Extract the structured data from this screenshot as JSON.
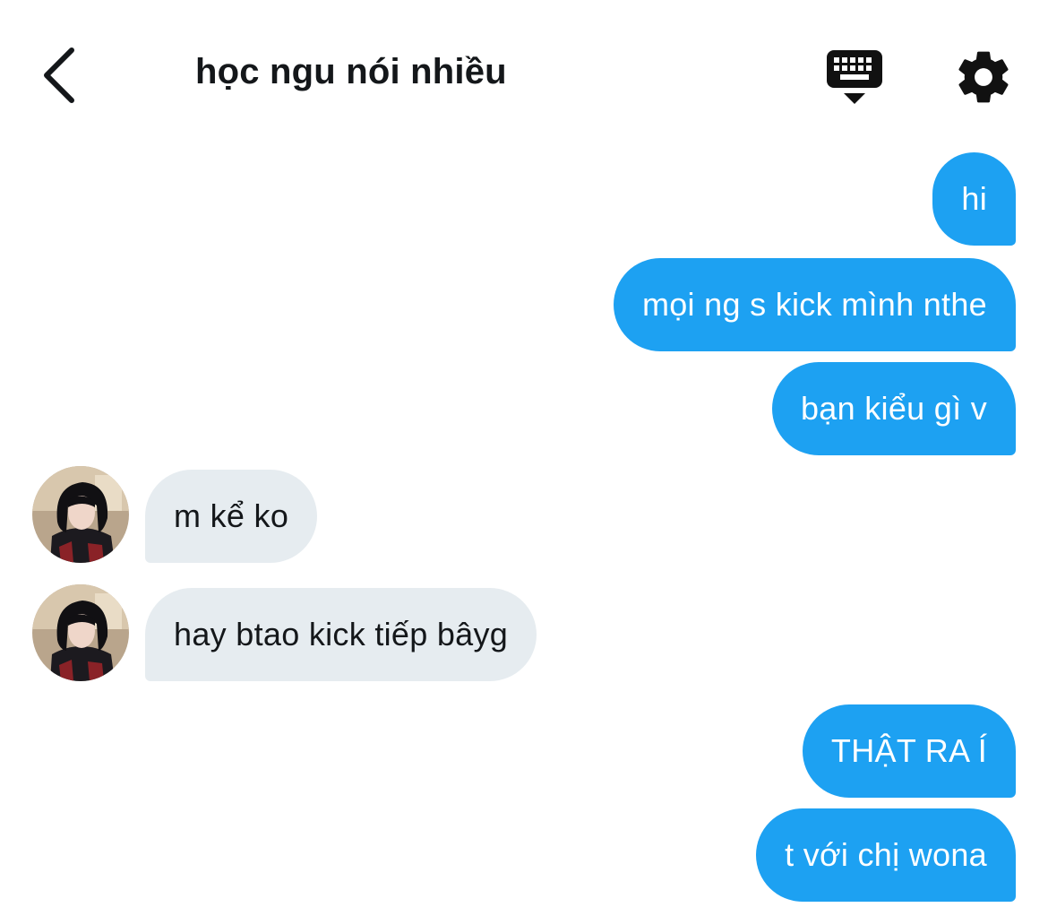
{
  "header": {
    "title": "học ngu nói nhiều",
    "back_icon": "chevron-left-icon",
    "keyboard_icon": "keyboard-hide-icon",
    "settings_icon": "gear-icon"
  },
  "colors": {
    "outgoing_bubble": "#1da1f2",
    "incoming_bubble": "#e6ecf0",
    "outgoing_text": "#ffffff",
    "incoming_text": "#14171a"
  },
  "messages": [
    {
      "direction": "outgoing",
      "text": "hi"
    },
    {
      "direction": "outgoing",
      "text": "mọi ng s kick mình nthe"
    },
    {
      "direction": "outgoing",
      "text": "bạn kiểu gì v"
    },
    {
      "direction": "incoming",
      "text": "m kể ko",
      "avatar": "profile-photo"
    },
    {
      "direction": "incoming",
      "text": "hay btao kick tiếp bâyg",
      "avatar": "profile-photo"
    },
    {
      "direction": "outgoing",
      "text": "THẬT RA Í"
    },
    {
      "direction": "outgoing",
      "text": "t với chị wona"
    }
  ]
}
